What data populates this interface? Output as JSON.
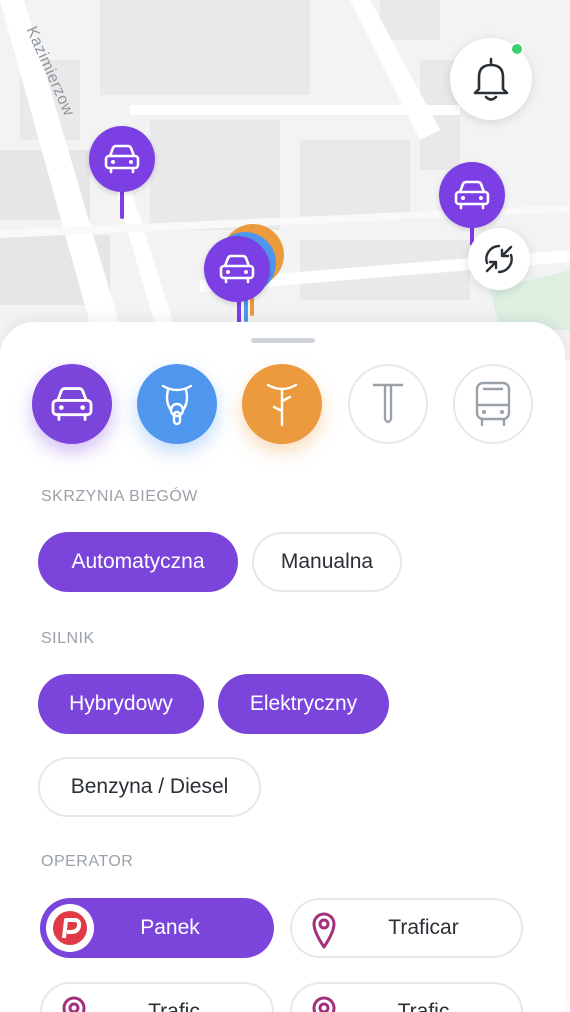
{
  "map": {
    "street_name": "Kazimierzow"
  },
  "colors": {
    "accent": "#7b45dc",
    "scooter": "#4f97ee",
    "bike": "#eb9a3d",
    "notification_dot": "#3fcf6e"
  },
  "transport_modes": [
    {
      "icon": "car-icon",
      "selected": true
    },
    {
      "icon": "scooter-icon",
      "selected": true
    },
    {
      "icon": "bike-icon",
      "selected": true
    },
    {
      "icon": "kick-scooter-icon",
      "selected": false
    },
    {
      "icon": "bus-icon",
      "selected": false
    }
  ],
  "gearbox": {
    "title": "SKRZYNIA BIEGÓW",
    "options": [
      {
        "label": "Automatyczna",
        "selected": true
      },
      {
        "label": "Manualna",
        "selected": false
      }
    ]
  },
  "engine": {
    "title": "SILNIK",
    "options": [
      {
        "label": "Hybrydowy",
        "selected": true
      },
      {
        "label": "Elektryczny",
        "selected": true
      },
      {
        "label": "Benzyna / Diesel",
        "selected": false
      }
    ]
  },
  "operator": {
    "title": "OPERATOR",
    "options": [
      {
        "label": "Panek",
        "selected": true
      },
      {
        "label": "Traficar",
        "selected": false
      },
      {
        "label": "Trafic",
        "selected": false
      },
      {
        "label": "Trafic",
        "selected": false
      }
    ]
  }
}
